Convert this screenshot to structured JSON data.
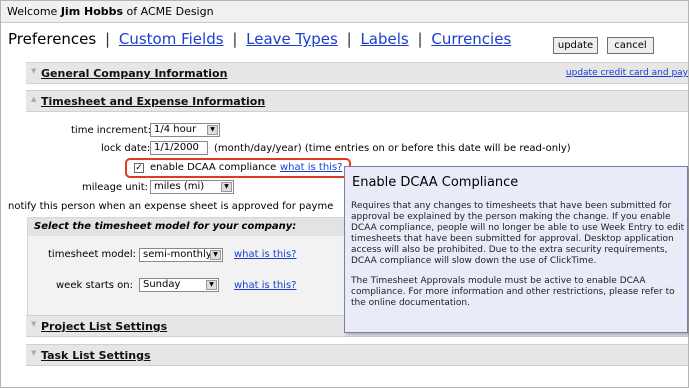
{
  "welcome": {
    "prefix": "Welcome ",
    "user": "Jim Hobbs",
    "suffix": " of ACME Design"
  },
  "nav": {
    "current": "Preferences",
    "sep": "|",
    "links": [
      "Custom Fields",
      "Leave Types",
      "Labels",
      "Currencies"
    ]
  },
  "buttons": {
    "update": "update",
    "cancel": "cancel"
  },
  "sections": {
    "general": {
      "title": "General Company Information",
      "right_link": "update credit card and pay"
    },
    "timesheet": {
      "title": "Timesheet and Expense Information"
    },
    "project": {
      "title": "Project List Settings"
    },
    "task": {
      "title": "Task List Settings"
    }
  },
  "form": {
    "time_increment_label": "time increment:",
    "time_increment_value": "1/4 hour",
    "lock_date_label": "lock date:",
    "lock_date_value": "1/1/2000",
    "lock_date_note": "(month/day/year) (time entries on or before this date will be read-only)",
    "dcaa_label": "enable DCAA compliance",
    "dcaa_checked": true,
    "what_is_this": "what is this?",
    "mileage_label": "mileage unit:",
    "mileage_value": "miles (mi)",
    "notify_label": "notify this person when an expense sheet is approved for payme"
  },
  "model_panel": {
    "heading": "Select the timesheet model for your company:",
    "model_label": "timesheet model:",
    "model_value": "semi-monthly",
    "week_label": "week starts on:",
    "week_value": "Sunday",
    "what_is_this": "what is this?"
  },
  "tooltip": {
    "title": "Enable DCAA Compliance",
    "p1": "Requires that any changes to timesheets that have been submitted for approval be explained by the person making the change. If you enable DCAA compliance, people will no longer be able to use Week Entry to edit timesheets that have been submitted for approval. Desktop application access will also be prohibited. Due to the extra security requirements, DCAA compliance will slow down the use of ClickTime.",
    "p2": "The Timesheet Approvals module must be active to enable DCAA compliance. For more information and other restrictions, please refer to the online documentation."
  },
  "colors": {
    "link": "#1a3ecf",
    "highlight": "#e03a1e",
    "tooltip_bg": "#e9ebf8"
  }
}
